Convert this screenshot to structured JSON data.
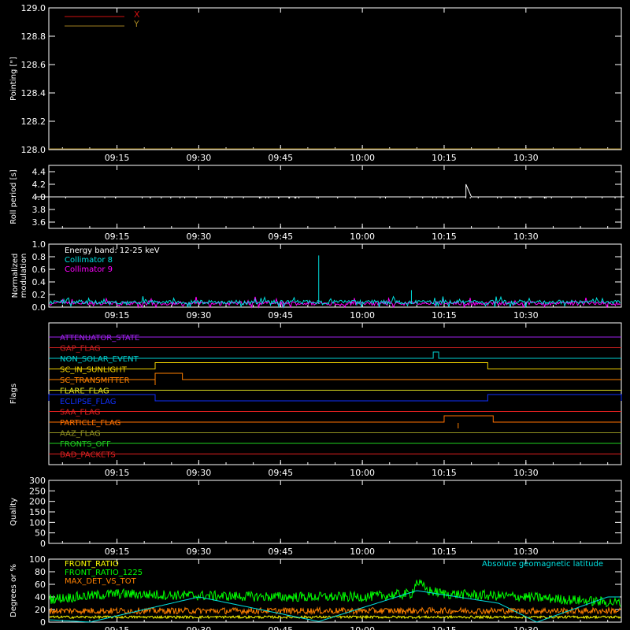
{
  "colors": {
    "background": "#000000",
    "axis": "#ffffff",
    "x_series": "#d01010",
    "y_series": "#a08020",
    "roll": "#ffffff",
    "coll8": "#00e0e0",
    "coll9": "#ff00ff",
    "front_ratio": "#ffff00",
    "front_ratio_1225": "#00ff00",
    "max_det": "#ff8000",
    "geolat": "#00e0e0"
  },
  "chart_data": [
    {
      "type": "line",
      "ylabel": "Pointing [\"]",
      "ylim": [
        128.0,
        129.0
      ],
      "yticks": [
        "128.0",
        "128.2",
        "128.4",
        "128.6",
        "128.8",
        "129.0"
      ],
      "xticks": [
        "09:15",
        "09:30",
        "09:45",
        "10:00",
        "10:15",
        "10:30"
      ],
      "legend": [
        {
          "name": "X",
          "color": "#d01010"
        },
        {
          "name": "Y",
          "color": "#a08020"
        }
      ],
      "series": [
        {
          "name": "X",
          "values": []
        },
        {
          "name": "Y",
          "values": []
        }
      ]
    },
    {
      "type": "line",
      "ylabel": "Roll period [s]",
      "ylim": [
        3.5,
        4.5
      ],
      "yticks": [
        "3.6",
        "3.8",
        "4.0",
        "4.2",
        "4.4"
      ],
      "xticks": [
        "09:15",
        "09:30",
        "09:45",
        "10:00",
        "10:15",
        "10:30"
      ],
      "series": [
        {
          "values": [
            4.0,
            4.0,
            4.0,
            4.2,
            4.0,
            4.0
          ],
          "x": [
            "09:00",
            "10:18",
            "10:19",
            "10:19",
            "10:20",
            "10:48"
          ]
        }
      ]
    },
    {
      "type": "line",
      "ylabel": [
        "Normalized",
        "modulation"
      ],
      "ylim": [
        0.0,
        1.0
      ],
      "yticks": [
        "0.0",
        "0.2",
        "0.4",
        "0.6",
        "0.8",
        "1.0"
      ],
      "xticks": [
        "09:15",
        "09:30",
        "09:45",
        "10:00",
        "10:15",
        "10:30"
      ],
      "legend": [
        {
          "name": "Energy band: 12-25 keV",
          "color": "#ffffff"
        },
        {
          "name": "Collimator 8",
          "color": "#00e0e0"
        },
        {
          "name": "Collimator 9",
          "color": "#ff00ff"
        }
      ],
      "series": [
        {
          "name": "Collimator 8",
          "baseline": 0.08,
          "spikes": [
            {
              "x": "09:52",
              "value": 0.82
            },
            {
              "x": "10:09",
              "value": 0.27
            }
          ]
        },
        {
          "name": "Collimator 9",
          "baseline": 0.06
        }
      ]
    },
    {
      "type": "line",
      "ylabel": "Flags",
      "xticks": [
        "09:15",
        "09:30",
        "09:45",
        "10:00",
        "10:15",
        "10:30"
      ],
      "flags": [
        {
          "name": "ATTENUATOR_STATE",
          "color": "#a020f0",
          "steps": []
        },
        {
          "name": "GAP_FLAG",
          "color": "#d02020",
          "steps": []
        },
        {
          "name": "NON_SOLAR_EVENT",
          "color": "#00d0d0",
          "steps": [
            [
              "10:13",
              "10:14"
            ]
          ]
        },
        {
          "name": "SC_IN_SUNLIGHT",
          "color": "#f0d000",
          "steps": [
            [
              "09:22",
              "10:23"
            ]
          ]
        },
        {
          "name": "SC_TRANSMITTER",
          "color": "#ff8000",
          "steps": [
            [
              "09:22",
              "09:27"
            ]
          ]
        },
        {
          "name": "FLARE_FLAG",
          "color": "#e0e020",
          "steps": []
        },
        {
          "name": "ECLIPSE_FLAG",
          "color": "#1030ff",
          "steps": [
            [
              "09:00",
              "09:22"
            ],
            [
              "10:23",
              "10:48"
            ]
          ]
        },
        {
          "name": "SAA_FLAG",
          "color": "#e02020",
          "steps": []
        },
        {
          "name": "PARTICLE_FLAG",
          "color": "#ff7000",
          "steps": [
            [
              "10:15",
              "10:24"
            ]
          ]
        },
        {
          "name": "AAZ_FLAG",
          "color": "#909020",
          "steps": []
        },
        {
          "name": "FRONTS_OFF",
          "color": "#20d020",
          "steps": []
        },
        {
          "name": "BAD_PACKETS",
          "color": "#e02020",
          "steps": []
        }
      ]
    },
    {
      "type": "line",
      "ylabel": "Quality",
      "ylim": [
        0,
        300
      ],
      "yticks": [
        "0",
        "50",
        "100",
        "150",
        "200",
        "250",
        "300"
      ],
      "xticks": [
        "09:15",
        "09:30",
        "09:45",
        "10:00",
        "10:15",
        "10:30"
      ],
      "series": []
    },
    {
      "type": "line",
      "ylabel": "Degrees or %",
      "ylim": [
        0,
        100
      ],
      "yticks": [
        "0",
        "20",
        "40",
        "60",
        "80",
        "100"
      ],
      "xticks": [
        "09:15",
        "09:30",
        "09:45",
        "10:00",
        "10:15",
        "10:30"
      ],
      "legend": [
        {
          "name": "FRONT_RATIO",
          "color": "#ffff00"
        },
        {
          "name": "FRONT_RATIO_1225",
          "color": "#00ff00"
        },
        {
          "name": "MAX_DET_VS_TOT",
          "color": "#ff8000"
        }
      ],
      "right_label": {
        "name": "Absolute geomagnetic latitude",
        "color": "#00e0e0"
      },
      "series": [
        {
          "name": "FRONT_RATIO_1225",
          "x": [
            "09:00",
            "09:15",
            "09:30",
            "09:45",
            "10:00",
            "10:09",
            "10:10",
            "10:12",
            "10:15",
            "10:30",
            "10:48"
          ],
          "values": [
            35,
            45,
            42,
            40,
            40,
            45,
            65,
            50,
            45,
            40,
            30
          ]
        },
        {
          "name": "MAX_DET_VS_TOT",
          "x": [
            "09:00",
            "10:48"
          ],
          "values": [
            18,
            18
          ]
        },
        {
          "name": "FRONT_RATIO",
          "x": [
            "09:00",
            "10:48"
          ],
          "values": [
            8,
            8
          ]
        },
        {
          "name": "Absolute geomagnetic latitude",
          "x": [
            "09:00",
            "09:10",
            "09:30",
            "09:52",
            "10:10",
            "10:25",
            "10:32",
            "10:45"
          ],
          "values": [
            5,
            0,
            40,
            1,
            50,
            30,
            0,
            40
          ]
        }
      ]
    }
  ]
}
